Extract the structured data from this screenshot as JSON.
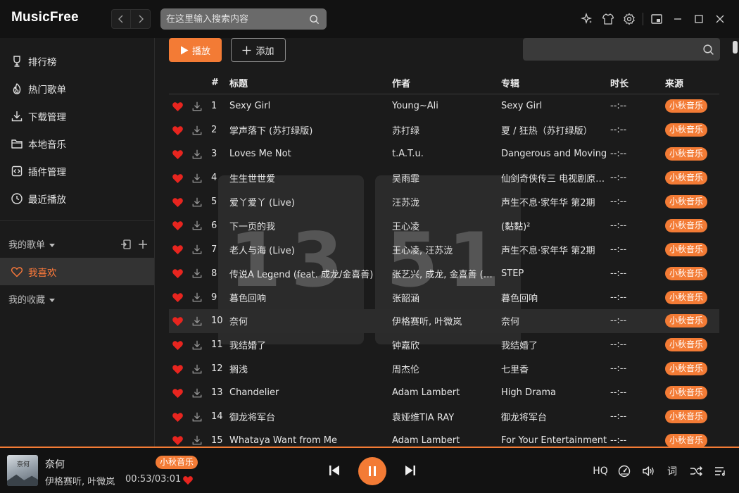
{
  "app": {
    "logo": "MusicFree"
  },
  "header": {
    "search_placeholder": "在这里输入搜索内容"
  },
  "sidebar": {
    "items": [
      {
        "label": "排行榜",
        "icon": "trophy-icon"
      },
      {
        "label": "热门歌单",
        "icon": "flame-icon"
      },
      {
        "label": "下载管理",
        "icon": "download-icon"
      },
      {
        "label": "本地音乐",
        "icon": "folder-icon"
      },
      {
        "label": "插件管理",
        "icon": "plugin-icon"
      },
      {
        "label": "最近播放",
        "icon": "clock-icon"
      }
    ],
    "my_playlists_label": "我的歌单",
    "favorites_label": "我喜欢",
    "my_collections_label": "我的收藏"
  },
  "toolbar": {
    "play_label": "播放",
    "add_label": "添加"
  },
  "watermark": {
    "left": "13",
    "right": "51"
  },
  "table": {
    "headers": {
      "num": "#",
      "title": "标题",
      "artist": "作者",
      "album": "专辑",
      "duration": "时长",
      "source": "来源"
    },
    "active_index": 9,
    "rows": [
      {
        "num": "1",
        "title": "Sexy Girl",
        "artist": "Young~Ali",
        "album": "Sexy Girl",
        "duration": "--:--",
        "source": "小秋音乐"
      },
      {
        "num": "2",
        "title": "掌声落下 (苏打绿版)",
        "artist": "苏打绿",
        "album": "夏 / 狂热（苏打绿版）",
        "duration": "--:--",
        "source": "小秋音乐"
      },
      {
        "num": "3",
        "title": "Loves Me Not",
        "artist": "t.A.T.u.",
        "album": "Dangerous and Moving",
        "duration": "--:--",
        "source": "小秋音乐"
      },
      {
        "num": "4",
        "title": "生生世世爱",
        "artist": "吴雨霏",
        "album": "仙剑奇侠传三 电视剧原声带",
        "duration": "--:--",
        "source": "小秋音乐"
      },
      {
        "num": "5",
        "title": "爱丫爱丫 (Live)",
        "artist": "汪苏泷",
        "album": "声生不息·家年华 第2期",
        "duration": "--:--",
        "source": "小秋音乐"
      },
      {
        "num": "6",
        "title": "下一页的我",
        "artist": "王心凌",
        "album": "(黏黏)²",
        "duration": "--:--",
        "source": "小秋音乐"
      },
      {
        "num": "7",
        "title": "老人与海 (Live)",
        "artist": "王心凌, 汪苏泷",
        "album": "声生不息·家年华 第2期",
        "duration": "--:--",
        "source": "小秋音乐"
      },
      {
        "num": "8",
        "title": "传说A Legend (feat. 成龙/金喜善)",
        "artist": "张艺兴, 成龙, 金喜善 (召唤)",
        "album": "STEP",
        "duration": "--:--",
        "source": "小秋音乐"
      },
      {
        "num": "9",
        "title": "暮色回响",
        "artist": "张韶涵",
        "album": "暮色回响",
        "duration": "--:--",
        "source": "小秋音乐"
      },
      {
        "num": "10",
        "title": "奈何",
        "artist": "伊格赛听, 叶微岚",
        "album": "奈何",
        "duration": "--:--",
        "source": "小秋音乐"
      },
      {
        "num": "11",
        "title": "我结婚了",
        "artist": "钟嘉欣",
        "album": "我结婚了",
        "duration": "--:--",
        "source": "小秋音乐"
      },
      {
        "num": "12",
        "title": "搁浅",
        "artist": "周杰伦",
        "album": "七里香",
        "duration": "--:--",
        "source": "小秋音乐"
      },
      {
        "num": "13",
        "title": "Chandelier",
        "artist": "Adam Lambert",
        "album": "High Drama",
        "duration": "--:--",
        "source": "小秋音乐"
      },
      {
        "num": "14",
        "title": "御龙将军台",
        "artist": "袁娅维TIA RAY",
        "album": "御龙将军台",
        "duration": "--:--",
        "source": "小秋音乐"
      },
      {
        "num": "15",
        "title": "Whataya Want from Me",
        "artist": "Adam Lambert",
        "album": "For Your Entertainment",
        "duration": "--:--",
        "source": "小秋音乐"
      }
    ]
  },
  "player": {
    "title": "奈何",
    "artist": "伊格赛听, 叶微岚",
    "time": "00:53/03:01",
    "source": "小秋音乐",
    "quality": "HQ",
    "lyrics_label": "词"
  },
  "colors": {
    "accent": "#f37b35",
    "heart": "#e8251f",
    "background": "#1b1b1b",
    "header": "#121212"
  }
}
